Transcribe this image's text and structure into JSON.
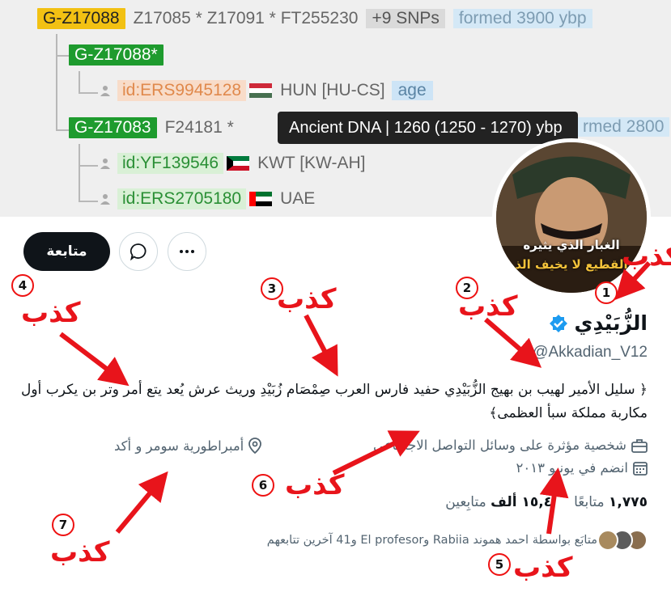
{
  "tree": {
    "root": {
      "node": "G-Z17088",
      "snps": "Z17085 * Z17091 * FT255230",
      "snp_count": "+9 SNPs",
      "formed": "formed 3900 ybp"
    },
    "child_a": {
      "node": "G-Z17088*"
    },
    "sample_1": {
      "id": "id:ERS9945128",
      "country": "HUN [HU-CS]",
      "age": "age"
    },
    "child_b": {
      "node": "G-Z17083",
      "snps": "F24181 *",
      "formed": "rmed 2800"
    },
    "sample_2": {
      "id": "id:YF139546",
      "country": "KWT [KW-AH]"
    },
    "sample_3": {
      "id": "id:ERS2705180",
      "country": "UAE"
    },
    "tooltip": "Ancient DNA | 1260 (1250 - 1270) ybp"
  },
  "avatar": {
    "text_line1": "الغبار الذي يثيره",
    "text_line2": "القطيع لا يخيف الذ"
  },
  "profile": {
    "follow_label": "متابعة",
    "display_name": "الزُّبَيْدِي",
    "handle": "@Akkadian_V12",
    "bio": "﴿ سليل الأمير لهيب بن بهيج الزُّبَيْدِي حفيد فارس العرب صِمْصَام زُبَيْدِ وريث عرش يُعد يتع أمر وتر بن يكرب أول مكاربة مملكة سبأ العظمى﴾",
    "category": "شخصية مؤثرة على وسائل التواصل الاجتماعي",
    "location": "أمبراطورية سومر و أكد",
    "joined": "انضم في يونيو ٢٠١٣",
    "following_count": "١,٧٧٥",
    "following_label": "متابعًا",
    "followers_count": "١٥,٤ ألف",
    "followers_label": "متابِعين",
    "followed_by": "متابَع بواسطة احمد هموند Rabiia وEl profesor و41 آخرين تتابعهم"
  },
  "annotations": {
    "lie_word": "كذب",
    "numbers": [
      "1",
      "2",
      "3",
      "4",
      "5",
      "6",
      "7"
    ]
  },
  "colors": {
    "annotation_red": "#e8141b",
    "verified_blue": "#1d9bf0",
    "root_node": "#f2c113",
    "green_node": "#1e9b2e"
  }
}
